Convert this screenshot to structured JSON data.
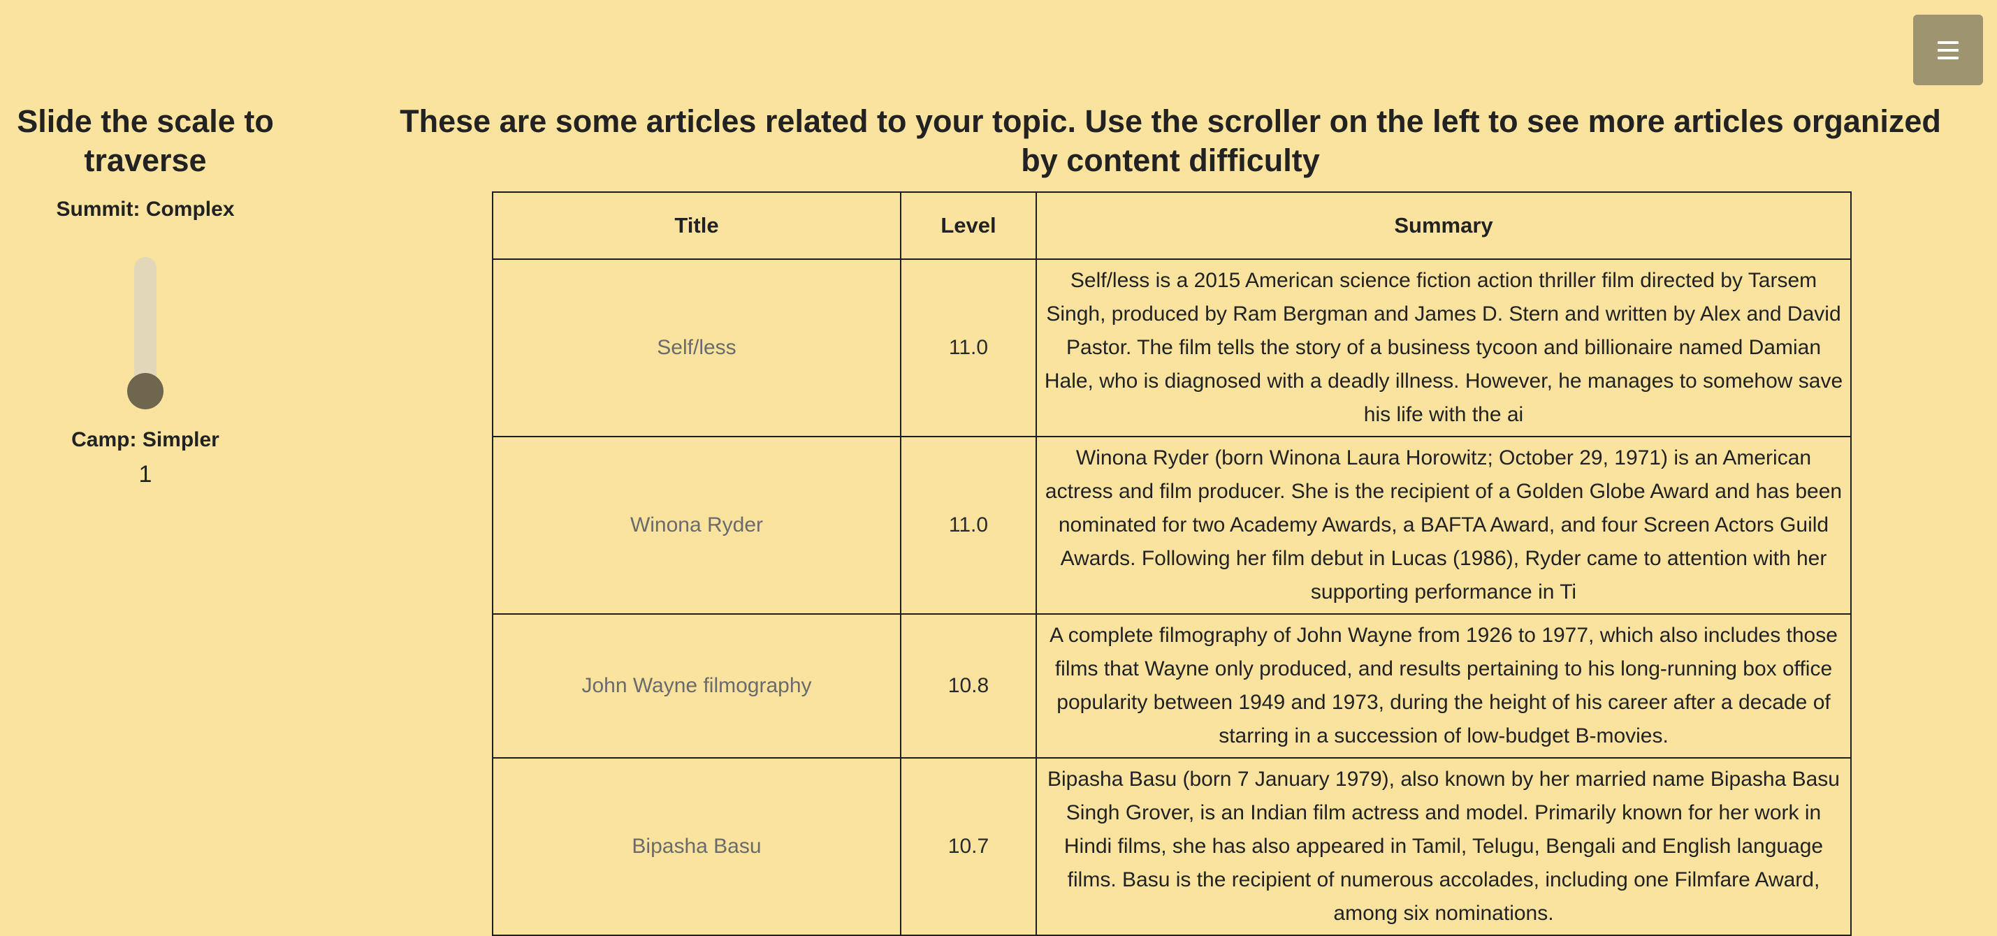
{
  "menu": {
    "icon": "hamburger-icon"
  },
  "sidebar": {
    "title": "Slide the scale to traverse",
    "summit_label": "Summit: Complex",
    "camp_label": "Camp: Simpler",
    "slider_value": "1",
    "slider_level": 0
  },
  "main": {
    "heading": "These are some articles related to your topic. Use the scroller on the left to see more articles organized by content difficulty"
  },
  "table": {
    "headers": {
      "title": "Title",
      "level": "Level",
      "summary": "Summary"
    },
    "rows": [
      {
        "title": "Self/less",
        "level": "11.0",
        "summary": "Self/less is a 2015 American science fiction action thriller film directed by Tarsem Singh, produced by Ram Bergman and James D. Stern and written by Alex and David Pastor. The film tells the story of a business tycoon and billionaire named Damian Hale, who is diagnosed with a deadly illness. However, he manages to somehow save his life with the ai"
      },
      {
        "title": "Winona Ryder",
        "level": "11.0",
        "summary": "Winona Ryder (born Winona Laura Horowitz; October 29, 1971) is an American actress and film producer. She is the recipient of a Golden Globe Award and has been nominated for two Academy Awards, a BAFTA Award, and four Screen Actors Guild Awards. Following her film debut in Lucas (1986), Ryder came to attention with her supporting performance in Ti"
      },
      {
        "title": "John Wayne filmography",
        "level": "10.8",
        "summary": "A complete filmography of John Wayne from 1926 to 1977, which also includes those films that Wayne only produced, and results pertaining to his long-running box office popularity between 1949 and 1973, during the height of his career after a decade of starring in a succession of low-budget B-movies."
      },
      {
        "title": "Bipasha Basu",
        "level": "10.7",
        "summary": "Bipasha Basu (born 7 January 1979), also known by her married name Bipasha Basu Singh Grover, is an Indian film actress and model. Primarily known for her work in Hindi films, she has also appeared in Tamil, Telugu, Bengali and English language films. Basu is the recipient of numerous accolades, including one Filmfare Award, among six nominations."
      }
    ]
  }
}
